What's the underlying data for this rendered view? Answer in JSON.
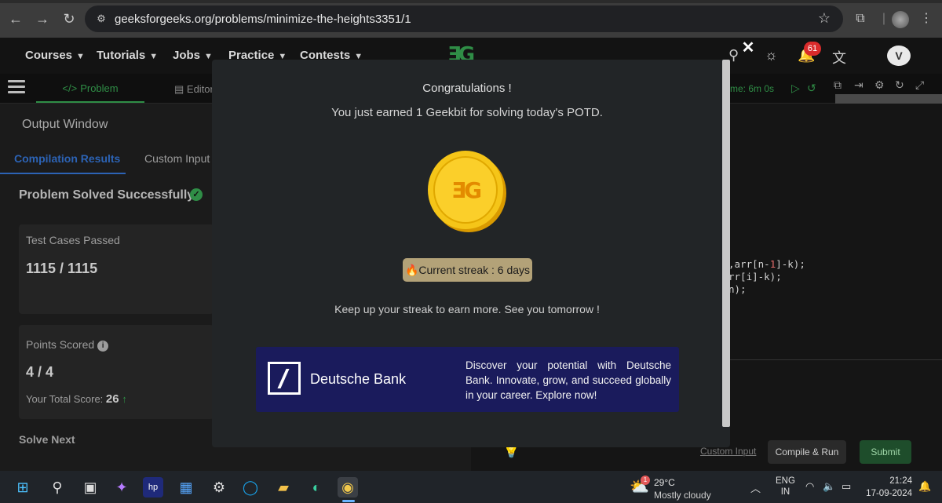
{
  "browser": {
    "url": "geeksforgeeks.org/problems/minimize-the-heights3351/1",
    "back_icon": "arrow-left",
    "forward_icon": "arrow-right",
    "reload_icon": "reload",
    "star_icon": "star",
    "extensions_icon": "puzzle"
  },
  "site_nav": {
    "items": [
      "Courses",
      "Tutorials",
      "Jobs",
      "Practice",
      "Contests"
    ],
    "logo": "ƎG",
    "notification_count": "61",
    "avatar_letter": "V"
  },
  "toolbar": {
    "problem_tab": "Problem",
    "problem_tab_icon": "</>",
    "editorial_tab": "Editor",
    "timer": "me: 6m 0s"
  },
  "output": {
    "title": "Output Window",
    "tabs": [
      "Compilation Results",
      "Custom Input"
    ],
    "status": "Problem Solved Successfully",
    "test_cases_label": "Test Cases Passed",
    "test_cases_value": "1115 / 1115",
    "points_label": "Points Scored",
    "points_value": "4 / 4",
    "total_score_label": "Your Total Score:",
    "total_score_value": "26",
    "total_score_arrow": "↑",
    "solve_next": "Solve Next"
  },
  "code": {
    "line1_a": ",arr[n-",
    "line1_num": "1",
    "line1_b": "]-k);",
    "line2": "rr[i]-k);",
    "line3": "n);"
  },
  "editor_bottom": {
    "custom_input": "Custom Input",
    "compile_run": "Compile & Run",
    "submit": "Submit"
  },
  "modal": {
    "close": "✕",
    "title": "Congratulations !",
    "message": "You just earned 1 Geekbit for solving today's POTD.",
    "streak_icon": "🔥",
    "streak": "Current streak : 6 days",
    "keep_up": "Keep up your streak to earn more. See you tomorrow !",
    "ad": {
      "brand": "Deutsche Bank",
      "text": "Discover your potential with Deutsche Bank. Innovate, grow, and succeed globally in your career. Explore now!"
    }
  },
  "taskbar": {
    "weather_temp": "29°C",
    "weather_condition": "Mostly cloudy",
    "weather_badge": "1",
    "lang_top": "ENG",
    "lang_bottom": "IN",
    "time": "21:24",
    "date": "17-09-2024"
  },
  "colors": {
    "accent_green": "#2f8d46",
    "modal_bg": "#222527",
    "ad_bg": "#1a1b5c",
    "streak_badge": "#b3a278"
  }
}
